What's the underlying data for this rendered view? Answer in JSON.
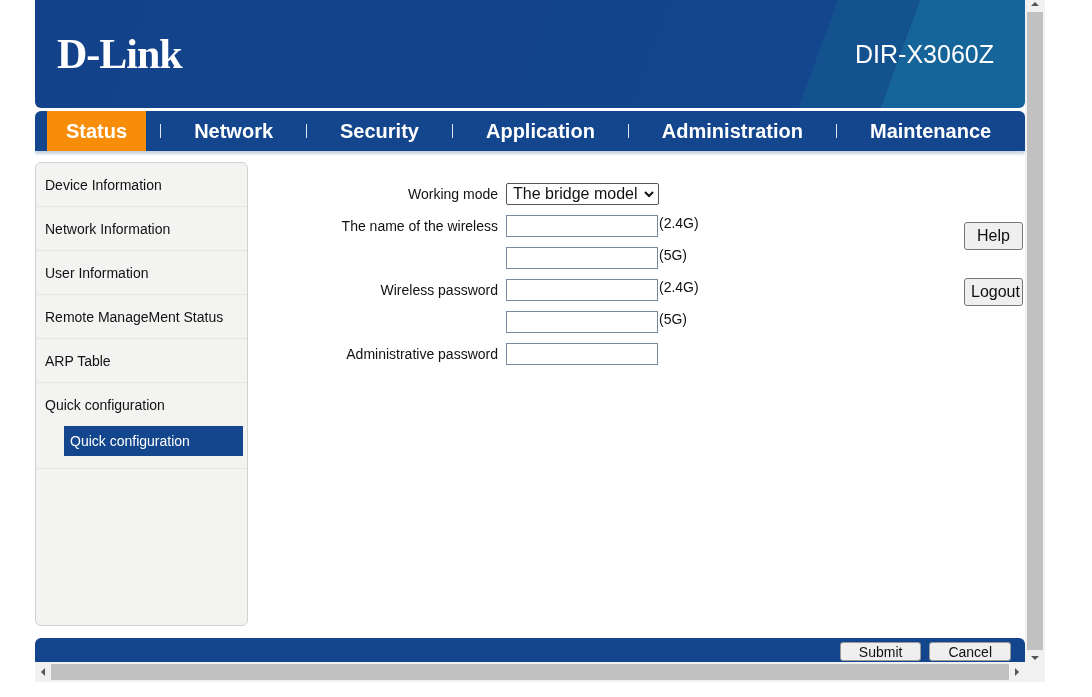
{
  "header": {
    "logo": "D-Link",
    "model": "DIR-X3060Z"
  },
  "nav": [
    {
      "label": "Status",
      "selected": true
    },
    {
      "label": "Network",
      "selected": false
    },
    {
      "label": "Security",
      "selected": false
    },
    {
      "label": "Application",
      "selected": false
    },
    {
      "label": "Administration",
      "selected": false
    },
    {
      "label": "Maintenance",
      "selected": false
    }
  ],
  "sidebar": {
    "items": [
      {
        "label": "Device Information",
        "selected": false
      },
      {
        "label": "Network Information",
        "selected": false
      },
      {
        "label": "User Information",
        "selected": false
      },
      {
        "label": "Remote ManageMent Status",
        "selected": false
      },
      {
        "label": "ARP Table",
        "selected": false
      },
      {
        "label": "Quick configuration",
        "selected": false,
        "children": [
          {
            "label": "Quick configuration",
            "selected": true
          }
        ]
      }
    ]
  },
  "form": {
    "rows": [
      {
        "kind": "select",
        "label": "Working mode",
        "value": "The bridge model"
      },
      {
        "kind": "input",
        "label": "The name of the wireless",
        "suffix": "(2.4G)"
      },
      {
        "kind": "input",
        "suffix": "(5G)"
      },
      {
        "kind": "input",
        "label": "Wireless password",
        "suffix": "(2.4G)"
      },
      {
        "kind": "input",
        "suffix": "(5G)"
      },
      {
        "kind": "input",
        "label": "Administrative password"
      }
    ]
  },
  "side_buttons": [
    "Help",
    "Logout"
  ],
  "footer_buttons": [
    "Submit",
    "Cancel"
  ]
}
